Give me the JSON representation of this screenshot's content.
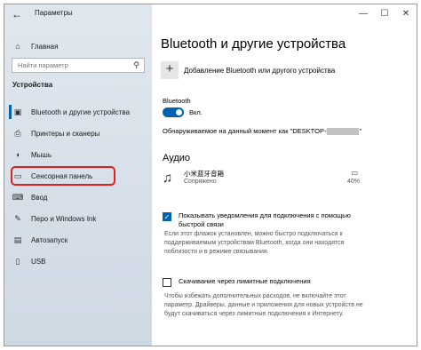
{
  "window": {
    "title": "Параметры",
    "back_icon": "arrow-left-icon",
    "controls": [
      "—",
      "☐",
      "✕"
    ]
  },
  "sidebar": {
    "home_label": "Главная",
    "search_placeholder": "Найти параметр",
    "section_title": "Устройства",
    "items": [
      {
        "label": "Bluetooth и другие устройства",
        "icon": "bluetooth-devices-icon",
        "active": true
      },
      {
        "label": "Принтеры и сканеры",
        "icon": "printer-icon"
      },
      {
        "label": "Мышь",
        "icon": "mouse-icon"
      },
      {
        "label": "Сенсорная панель",
        "icon": "touchpad-icon",
        "highlighted": true
      },
      {
        "label": "Ввод",
        "icon": "keyboard-icon"
      },
      {
        "label": "Перо и Windows Ink",
        "icon": "pen-icon"
      },
      {
        "label": "Автозапуск",
        "icon": "autoplay-icon"
      },
      {
        "label": "USB",
        "icon": "usb-icon"
      }
    ]
  },
  "main": {
    "title": "Bluetooth и другие устройства",
    "add_device_label": "Добавление Bluetooth или другого устройства",
    "bluetooth_label": "Bluetooth",
    "toggle_state": "Вкл.",
    "discoverable_text": "Обнаруживаемое на данный момент как \"DESKTOP-",
    "discoverable_suffix": "\"",
    "audio_title": "Аудио",
    "device": {
      "name": "小米蓝牙音箱",
      "status": "Сопряжено",
      "battery": "40%"
    },
    "notify_checkbox": {
      "label": "Показывать уведомления для подключения с помощью быстрой связи",
      "checked": true,
      "description": "Если этот флажок установлен, можно быстро подключаться к поддерживаемым устройствам Bluetooth, когда они находятся поблизости и в режиме связывания."
    },
    "metered_checkbox": {
      "label": "Скачивание через лимитные подключения",
      "checked": false,
      "description": "Чтобы избежать дополнительных расходов, не включайте этот параметр. Драйверы, данные и приложения для новых устройств не будут скачиваться через лимитные подключения к Интернету."
    }
  },
  "colors": {
    "accent": "#0063b1",
    "highlight_box": "#e02020",
    "sidebar_bg": "#dfe6ee"
  }
}
